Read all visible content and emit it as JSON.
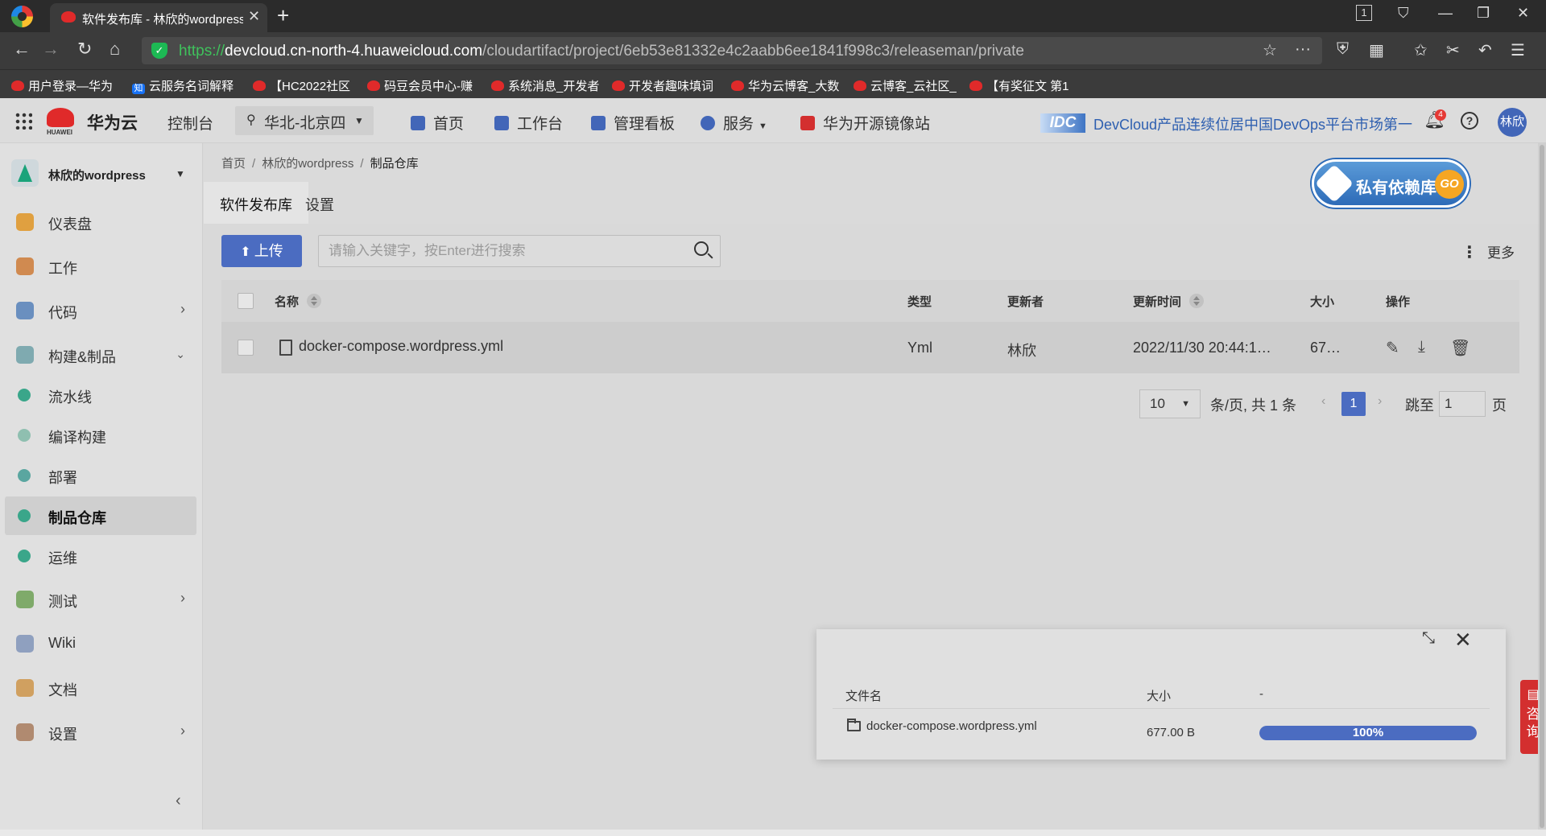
{
  "browser": {
    "tab_title": "软件发布库 - 林欣的wordpress",
    "tab_count": "1",
    "url_scheme": "https://",
    "url_host": "devcloud.cn-north-4.huaweicloud.com",
    "url_path": "/cloudartifact/project/6eb53e81332e4c2aabb6ee1841f998c3/releaseman/private",
    "bookmarks": [
      "用户登录—华为",
      "云服务名词解释",
      "【HC2022社区",
      "码豆会员中心-赚",
      "系统消息_开发者",
      "开发者趣味填词",
      "华为云博客_大数",
      "云博客_云社区_",
      "【有奖征文 第1"
    ]
  },
  "header": {
    "logo_sub": "HUAWEI",
    "brand": "华为云",
    "console": "控制台",
    "region": "华北-北京四",
    "nav": [
      "首页",
      "工作台",
      "管理看板",
      "服务",
      "华为开源镜像站"
    ],
    "idc_badge": "IDC",
    "idc_text": "DevCloud产品连续位居中国DevOps平台市场第一",
    "notification_count": "4",
    "help": "?",
    "avatar": "林欣"
  },
  "sidebar": {
    "project": "林欣的wordpress",
    "items": [
      {
        "label": "仪表盘"
      },
      {
        "label": "工作"
      },
      {
        "label": "代码"
      },
      {
        "label": "构建&制品"
      },
      {
        "label": "流水线"
      },
      {
        "label": "编译构建"
      },
      {
        "label": "部署"
      },
      {
        "label": "制品仓库"
      },
      {
        "label": "运维"
      },
      {
        "label": "测试"
      },
      {
        "label": "Wiki"
      },
      {
        "label": "文档"
      },
      {
        "label": "设置"
      }
    ]
  },
  "main": {
    "breadcrumb": [
      "首页",
      "林欣的wordpress",
      "制品仓库"
    ],
    "promo": {
      "text": "私有依赖库",
      "go": "GO"
    },
    "tabs": [
      "软件发布库",
      "设置"
    ],
    "upload_label": "上传",
    "search_placeholder": "请输入关键字，按Enter进行搜索",
    "more_label": "更多",
    "table": {
      "headers": [
        "名称",
        "类型",
        "更新者",
        "更新时间",
        "大小",
        "操作"
      ],
      "rows": [
        {
          "name": "docker-compose.wordpress.yml",
          "type": "Yml",
          "updater": "林欣",
          "updated": "2022/11/30 20:44:1…",
          "size": "67…"
        }
      ]
    },
    "pagination": {
      "page_size": "10",
      "summary": "条/页, 共 1 条",
      "current": "1",
      "jump_label": "跳至",
      "jump_value": "1",
      "page_unit": "页"
    }
  },
  "upload_panel": {
    "headers": [
      "文件名",
      "大小",
      "-"
    ],
    "file": {
      "name": "docker-compose.wordpress.yml",
      "size": "677.00 B",
      "progress_percent": 100,
      "progress_label": "100%"
    }
  },
  "consult": "咨询",
  "colors": {
    "accent": "#4b6cc1",
    "brand_red": "#e02a2a",
    "consult_red": "#d32f2f"
  }
}
